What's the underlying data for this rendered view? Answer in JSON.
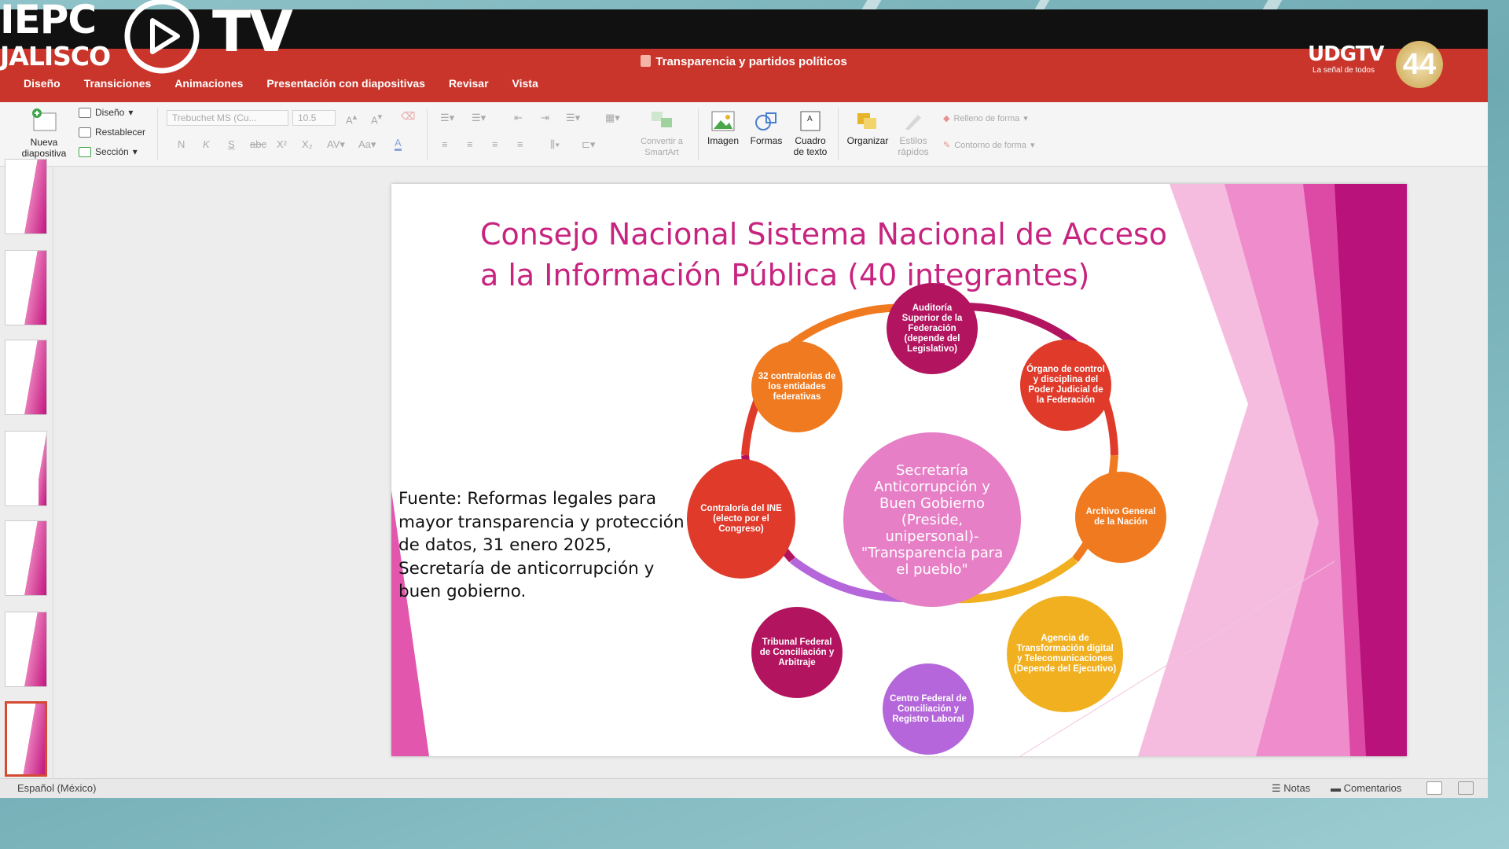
{
  "app": {
    "document_title": "Transparencia y partidos políticos",
    "tabs": [
      "Diseño",
      "Transiciones",
      "Animaciones",
      "Presentación con diapositivas",
      "Revisar",
      "Vista"
    ]
  },
  "ribbon": {
    "new_slide": "Nueva diapositiva",
    "layout": "Diseño",
    "reset": "Restablecer",
    "section": "Sección",
    "font_name": "Trebuchet MS (Cu...",
    "font_size": "10.5",
    "bold": "N",
    "italic": "K",
    "underline": "S",
    "strike": "abc",
    "superscript": "X²",
    "subscript": "X₂",
    "convert_smartart": "Convertir a SmartArt",
    "image": "Imagen",
    "shapes": "Formas",
    "textbox": "Cuadro de texto",
    "arrange": "Organizar",
    "quick_styles": "Estilos rápidos",
    "shape_fill": "Relleno de forma",
    "shape_outline": "Contorno de forma"
  },
  "slide": {
    "title": "Consejo Nacional Sistema Nacional de Acceso a la Información Pública (40 integrantes)",
    "source": "Fuente: Reformas legales para mayor transparencia y protección de datos, 31 enero 2025, Secretaría de anticorrupción y buen gobierno.",
    "center": "Secretaría Anticorrupción y Buen Gobierno (Preside, unipersonal)- \"Transparencia para el pueblo\"",
    "nodes": [
      {
        "label": "Auditoría Superior de la Federación (depende del Legislativo)",
        "color": "#b3145f"
      },
      {
        "label": "Órgano de control y disciplina del Poder Judicial de la Federación",
        "color": "#df3a2a"
      },
      {
        "label": "Archivo General de la Nación",
        "color": "#f07a1f"
      },
      {
        "label": "Agencia de Transformación digital y Telecomunicaciones (Depende del Ejecutivo)",
        "color": "#f0b020"
      },
      {
        "label": "Centro Federal de Conciliación y Registro Laboral",
        "color": "#b466da"
      },
      {
        "label": "Tribunal Federal de Conciliación y Arbitraje",
        "color": "#b3145f"
      },
      {
        "label": "Contraloría del INE (electo por el Congreso)",
        "color": "#df3a2a"
      },
      {
        "label": "32 contralorías de los entidades federativas",
        "color": "#f07a1f"
      }
    ]
  },
  "statusbar": {
    "language": "Español (México)",
    "notes": "Notas",
    "comments": "Comentarios"
  },
  "overlay": {
    "left_logo_line1": "IEPC",
    "left_logo_line2": "JALISCO",
    "left_logo_tv": "TV",
    "right_logo": "UDGTV",
    "right_logo_tagline": "La señal de todos",
    "right_logo_channel": "44"
  }
}
